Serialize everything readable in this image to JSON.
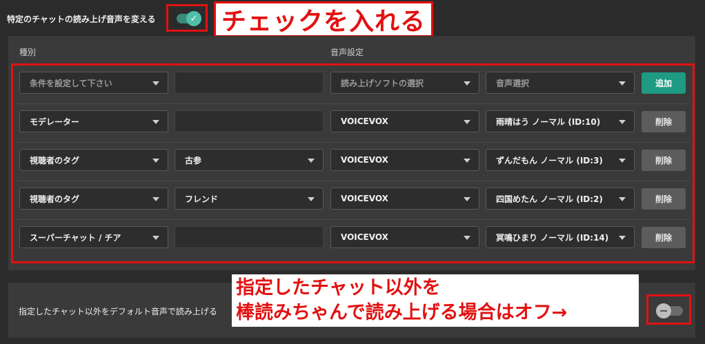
{
  "top": {
    "label": "特定のチャットの読み上げ音声を変える",
    "toggle_on": true,
    "check_icon": "✓",
    "annotation": "チェックを入れる"
  },
  "table": {
    "headers": {
      "type": "種別",
      "voice": "音声設定"
    },
    "rows": [
      {
        "type": "条件を設定して下さい",
        "type_placeholder": true,
        "sub": "",
        "soft": "読み上げソフトの選択",
        "soft_placeholder": true,
        "voice": "音声選択",
        "voice_placeholder": true,
        "button": "追加",
        "button_kind": "add"
      },
      {
        "type": "モデレーター",
        "sub": "",
        "soft": "VOICEVOX",
        "voice": "雨晴はう ノーマル (ID:10)",
        "button": "削除",
        "button_kind": "del"
      },
      {
        "type": "視聴者のタグ",
        "sub": "古参",
        "soft": "VOICEVOX",
        "voice": "ずんだもん ノーマル (ID:3)",
        "button": "削除",
        "button_kind": "del"
      },
      {
        "type": "視聴者のタグ",
        "sub": "フレンド",
        "soft": "VOICEVOX",
        "voice": "四国めたん ノーマル (ID:2)",
        "button": "削除",
        "button_kind": "del"
      },
      {
        "type": "スーパーチャット / チア",
        "sub": "",
        "soft": "VOICEVOX",
        "voice": "冥鳴ひまり ノーマル (ID:14)",
        "button": "削除",
        "button_kind": "del"
      }
    ]
  },
  "bottom": {
    "label": "指定したチャット以外をデフォルト音声で読み上げる",
    "toggle_on": false,
    "annotation_line1": "指定したチャット以外を",
    "annotation_line2": "棒読みちゃんで読み上げる場合はオフ→"
  },
  "colors": {
    "accent": "#1e9b82",
    "annotation_red": "#e21111",
    "background": "#2b2b2b",
    "panel": "#3a3a3a"
  }
}
